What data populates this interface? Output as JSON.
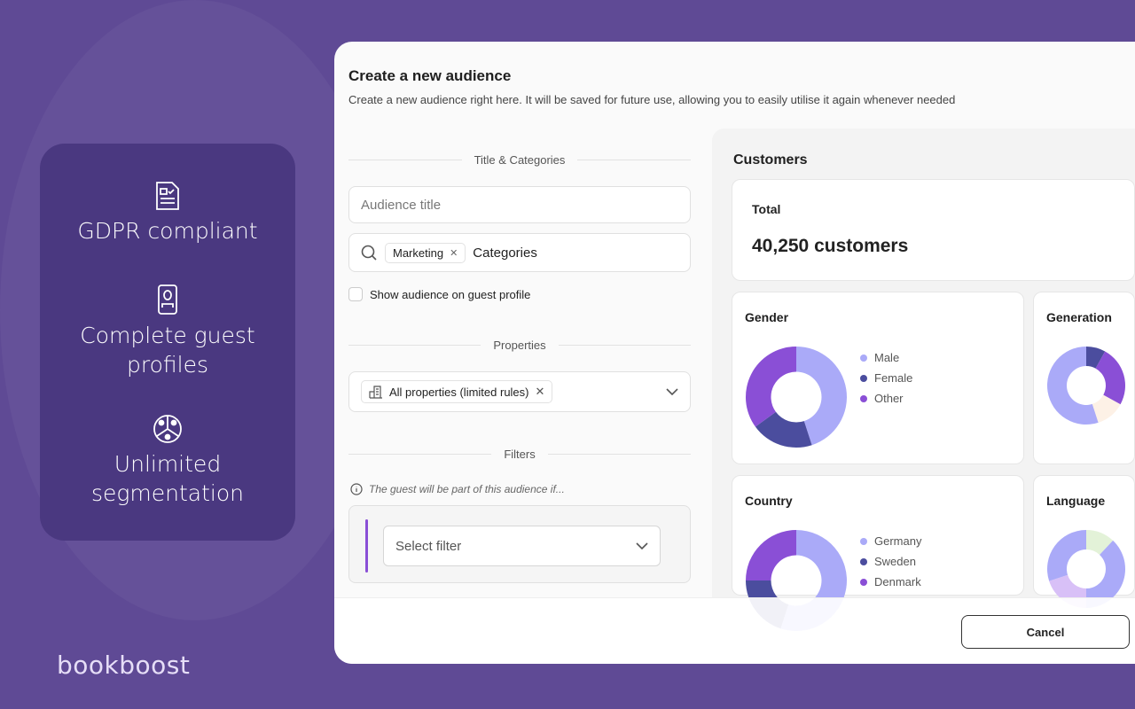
{
  "features": [
    {
      "icon": "document-check-icon",
      "label": "GDPR compliant"
    },
    {
      "icon": "guest-profile-icon",
      "label": "Complete guest profiles"
    },
    {
      "icon": "segmentation-icon",
      "label": "Unlimited segmentation"
    }
  ],
  "logo": "bookboost",
  "dialog": {
    "title": "Create a new audience",
    "subtitle": "Create a new audience right here. It will be saved for future use, allowing you to easily utilise it again whenever needed",
    "sections": {
      "title_categories": "Title & Categories",
      "properties": "Properties",
      "filters": "Filters"
    },
    "audience_title_placeholder": "Audience title",
    "category_chip": "Marketing",
    "categories_placeholder": "Categories",
    "show_on_profile_label": "Show audience on guest profile",
    "show_on_profile_checked": false,
    "property_chip": "All properties (limited rules)",
    "filters_hint": "The guest will be part of this audience if...",
    "select_filter_placeholder": "Select filter",
    "cancel_label": "Cancel"
  },
  "customers": {
    "heading": "Customers",
    "total_label": "Total",
    "total_value": "40,250 customers"
  },
  "chart_data": [
    {
      "type": "pie",
      "title": "Gender",
      "categories": [
        "Male",
        "Female",
        "Other"
      ],
      "values": [
        45,
        20,
        35
      ],
      "colors": [
        "#aaaaf8",
        "#4b4d9e",
        "#8a4fd6"
      ]
    },
    {
      "type": "pie",
      "title": "Country",
      "categories": [
        "Germany",
        "Sweden",
        "Denmark"
      ],
      "values": [
        55,
        20,
        25
      ],
      "colors": [
        "#aaaaf8",
        "#4b4d9e",
        "#8a4fd6"
      ]
    },
    {
      "type": "pie",
      "title": "Generation",
      "categories": [],
      "values": [
        8,
        25,
        12,
        55
      ],
      "colors": [
        "#4b4d9e",
        "#8a4fd6",
        "#fdf1e6",
        "#aaaaf8"
      ]
    },
    {
      "type": "pie",
      "title": "Language",
      "categories": [],
      "values": [
        12,
        38,
        20,
        30
      ],
      "colors": [
        "#e3f2d8",
        "#aaaaf8",
        "#d8c0f7",
        "#aaaaf8"
      ]
    }
  ]
}
